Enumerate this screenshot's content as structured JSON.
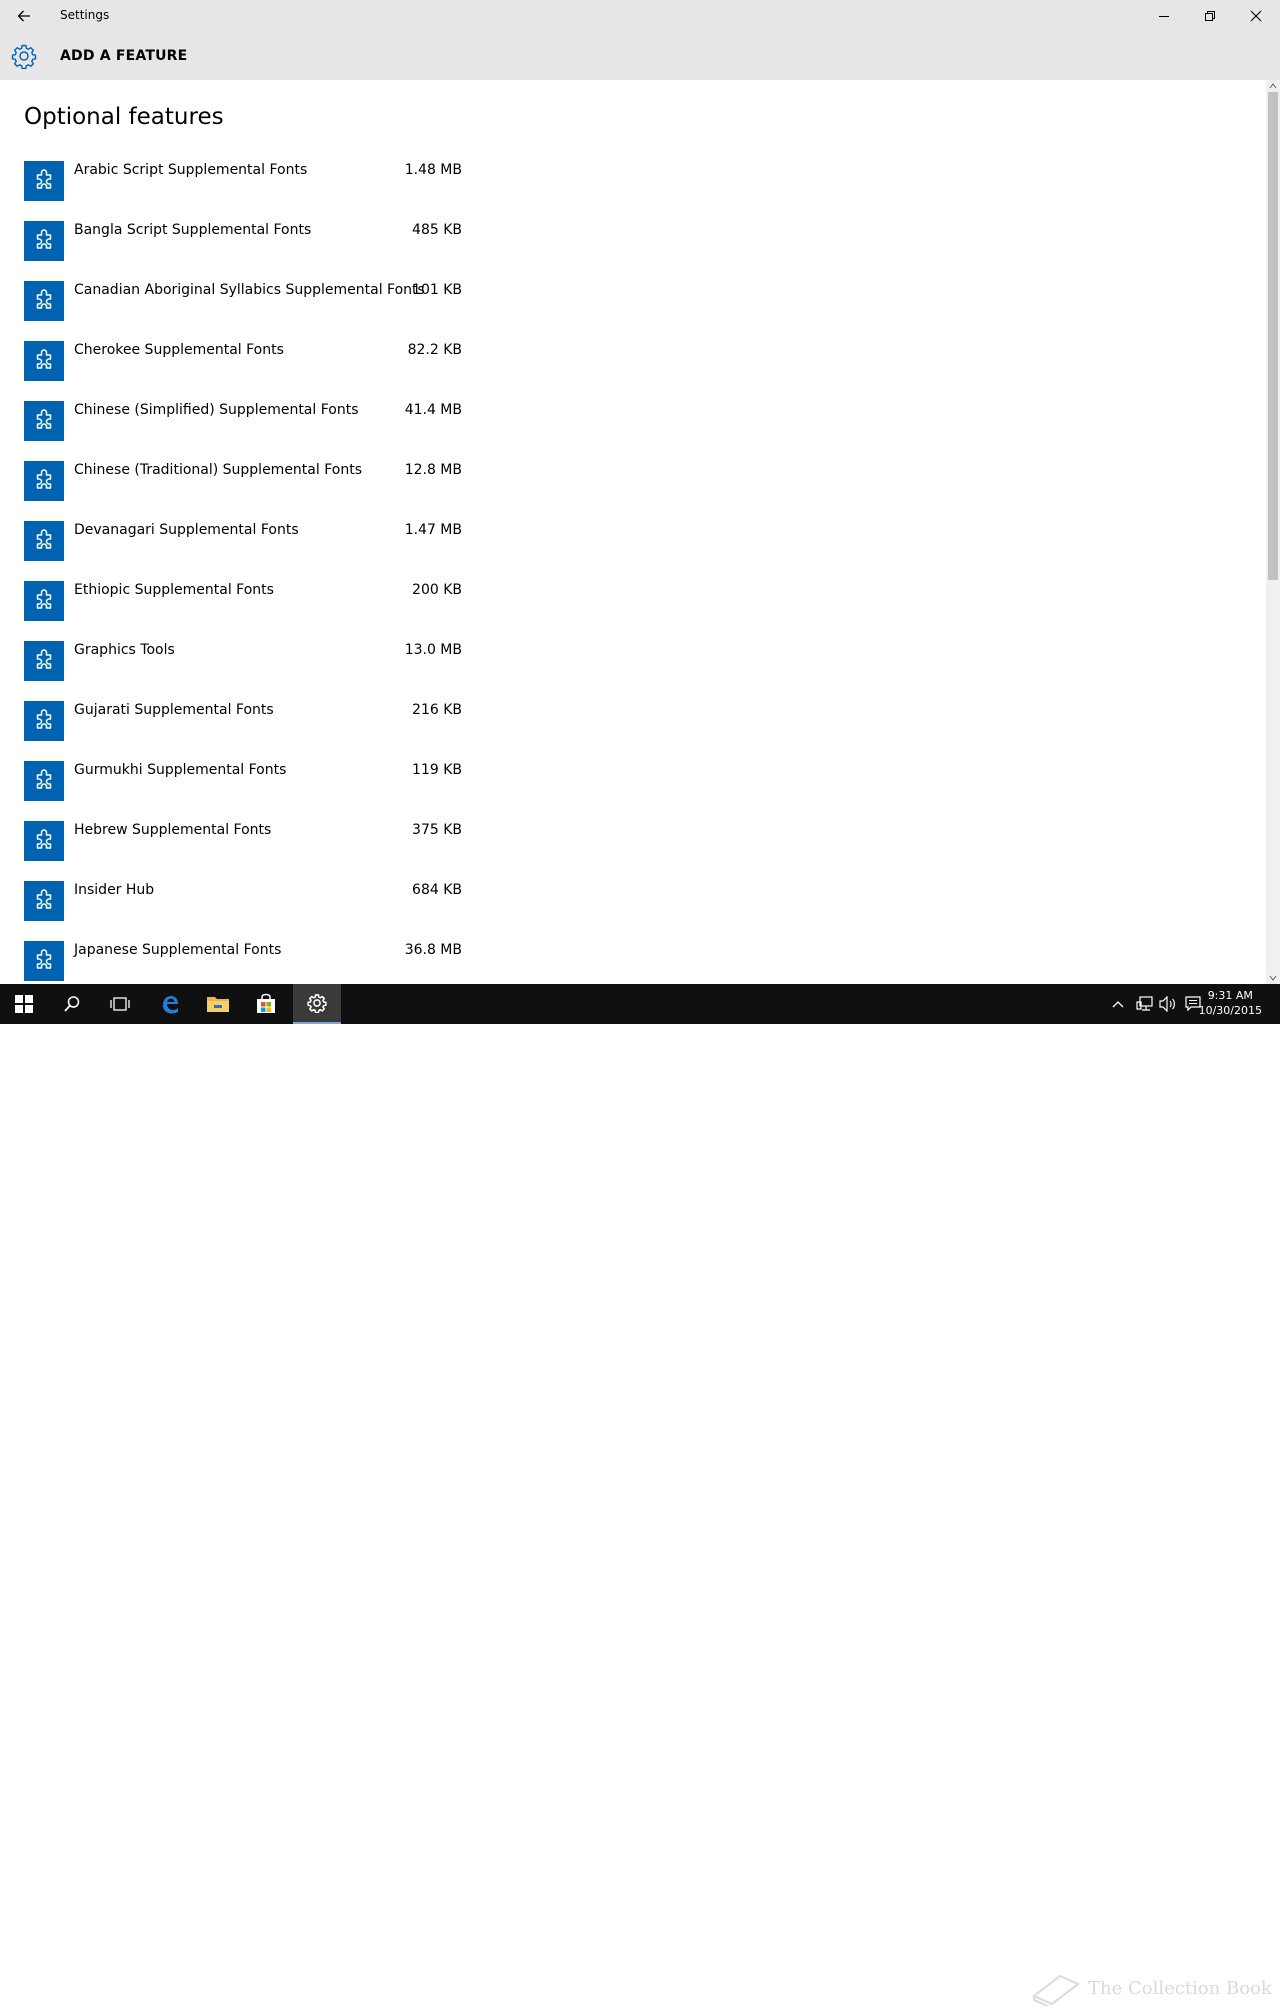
{
  "window": {
    "title": "Settings"
  },
  "header": {
    "title": "ADD A FEATURE"
  },
  "main": {
    "section_title": "Optional features",
    "features": [
      {
        "name": "Arabic Script Supplemental Fonts",
        "size": "1.48 MB"
      },
      {
        "name": "Bangla Script Supplemental Fonts",
        "size": "485 KB"
      },
      {
        "name": "Canadian Aboriginal Syllabics Supplemental Fonts",
        "size": "101 KB"
      },
      {
        "name": "Cherokee Supplemental Fonts",
        "size": "82.2 KB"
      },
      {
        "name": "Chinese (Simplified) Supplemental Fonts",
        "size": "41.4 MB"
      },
      {
        "name": "Chinese (Traditional) Supplemental Fonts",
        "size": "12.8 MB"
      },
      {
        "name": "Devanagari Supplemental Fonts",
        "size": "1.47 MB"
      },
      {
        "name": "Ethiopic Supplemental Fonts",
        "size": "200 KB"
      },
      {
        "name": "Graphics Tools",
        "size": "13.0 MB"
      },
      {
        "name": "Gujarati Supplemental Fonts",
        "size": "216 KB"
      },
      {
        "name": "Gurmukhi Supplemental Fonts",
        "size": "119 KB"
      },
      {
        "name": "Hebrew Supplemental Fonts",
        "size": "375 KB"
      },
      {
        "name": "Insider Hub",
        "size": "684 KB"
      },
      {
        "name": "Japanese Supplemental Fonts",
        "size": "36.8 MB"
      }
    ]
  },
  "taskbar": {
    "clock_time": "9:31 AM",
    "clock_date": "10/30/2015",
    "watermark": "The Collection Book"
  },
  "colors": {
    "accent": "#0063b1",
    "header_bg": "#e6e6e6",
    "taskbar_bg": "#101010"
  },
  "icons": {
    "feature": "puzzle-piece-icon",
    "header": "gear-icon"
  }
}
